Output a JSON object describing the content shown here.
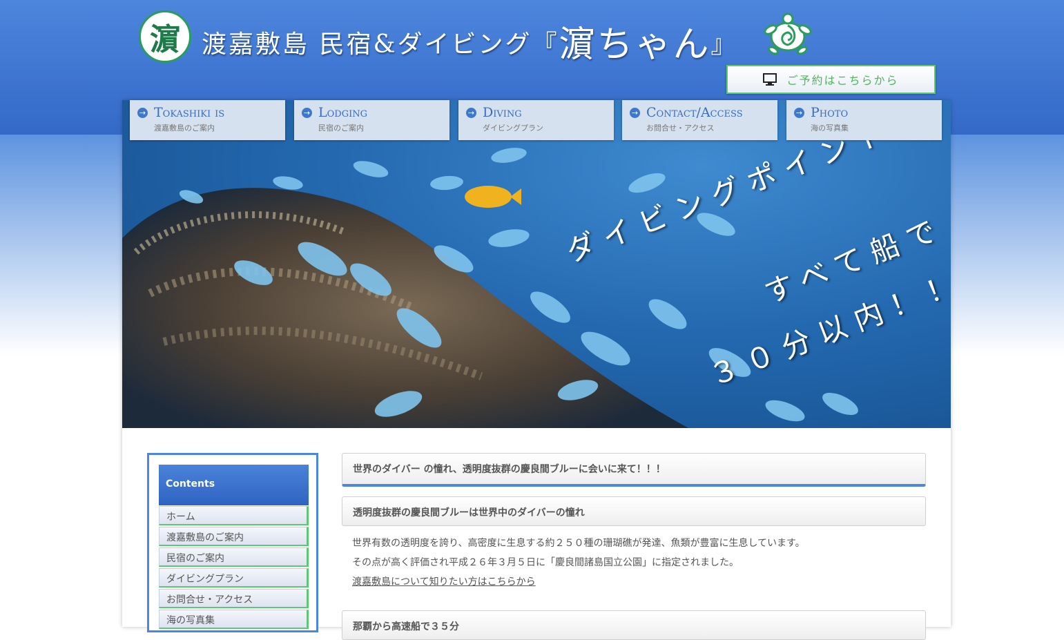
{
  "header": {
    "logo_char": "濵",
    "title_part1": "渡嘉敷島 民宿&ダイビング『",
    "title_name": "濵ちゃん",
    "title_end": "』",
    "reserve_label": "ご予約はこちらから"
  },
  "nav": [
    {
      "title": "Tokashiki is",
      "sub": "渡嘉敷島のご案内"
    },
    {
      "title": "Lodging",
      "sub": "民宿のご案内"
    },
    {
      "title": "Diving",
      "sub": "ダイビングプラン"
    },
    {
      "title": "Contact/Access",
      "sub": "お問合せ・アクセス"
    },
    {
      "title": "Photo",
      "sub": "海の写真集"
    }
  ],
  "hero": {
    "line1": "ダイビングポイントは",
    "line2": "すべて船で",
    "line3": "３０分以内！！"
  },
  "sidebar": {
    "heading": "Contents",
    "items": [
      "ホーム",
      "渡嘉敷島のご案内",
      "民宿のご案内",
      "ダイビングプラン",
      "お問合せ・アクセス",
      "海の写真集"
    ]
  },
  "content": {
    "main_heading": "世界のダイバー の憧れ、透明度抜群の慶良間ブルーに会いに来て！！！",
    "section1_heading": "透明度抜群の慶良間ブルーは世界中のダイバーの憧れ",
    "section1_para1": "世界有数の透明度を誇り、高密度に生息する約２５０種の珊瑚礁が発達、魚類が豊富に生息しています。",
    "section1_para2": "その点が高く評価され平成２６年３月５日に「慶良間諸島国立公園」に指定されました。",
    "section1_link": "渡嘉敷島について知りたい方はこちらから",
    "section2_heading": "那覇から高速船で３５分"
  }
}
